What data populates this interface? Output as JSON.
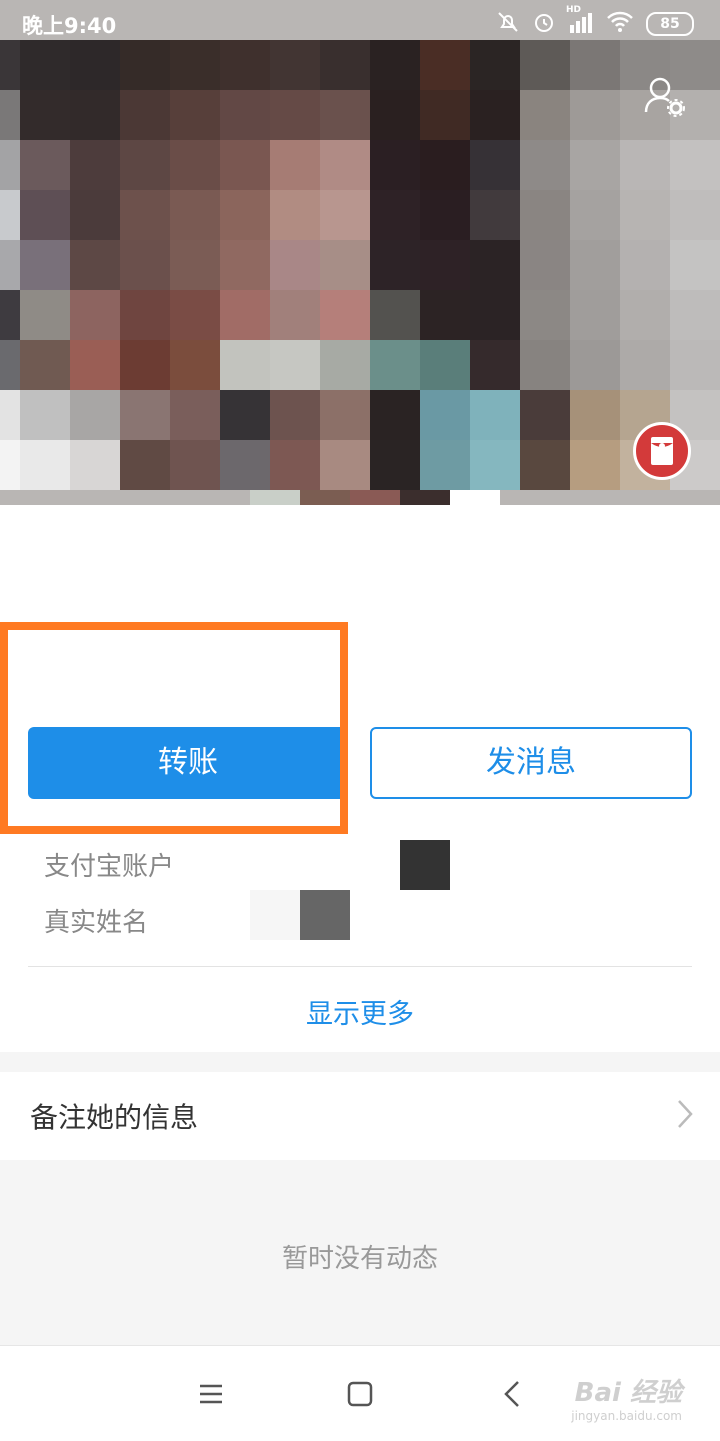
{
  "status_bar": {
    "time": "晚上9:40",
    "battery": "85",
    "network_label": "HD",
    "icons": [
      "mute-bell-icon",
      "alarm-icon",
      "signal-icon",
      "wifi-icon",
      "battery-icon"
    ]
  },
  "profile": {
    "settings_icon": "user-settings-icon",
    "red_packet_icon": "red-packet-icon"
  },
  "actions": {
    "transfer_label": "转账",
    "message_label": "发消息"
  },
  "info": {
    "account_label": "支付宝账户",
    "real_name_label": "真实姓名",
    "show_more": "显示更多"
  },
  "remark": {
    "label": "备注她的信息"
  },
  "feed": {
    "empty_text": "暂时没有动态"
  },
  "nav": {
    "items": [
      "menu-icon",
      "home-icon",
      "back-icon"
    ]
  },
  "watermark": {
    "brand": "Bai 经验",
    "url": "jingyan.baidu.com"
  },
  "colors": {
    "accent": "#1e8ee8",
    "highlight": "#ff7a22",
    "red_packet": "#d33a3a"
  }
}
